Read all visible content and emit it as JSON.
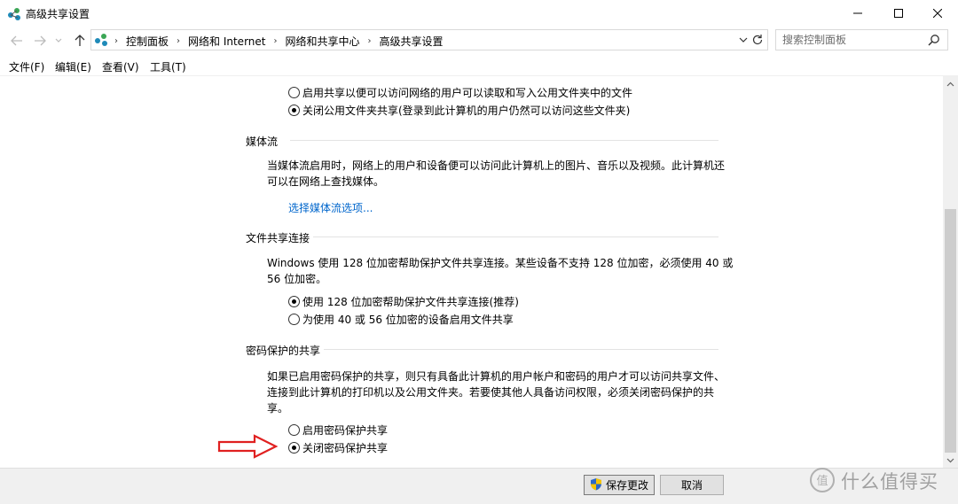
{
  "window": {
    "title": "高级共享设置",
    "minimize_glyph": "–",
    "maximize_glyph": "□",
    "close_glyph": "✕"
  },
  "nav": {
    "breadcrumbs": [
      "控制面板",
      "网络和 Internet",
      "网络和共享中心",
      "高级共享设置"
    ],
    "separator": "›",
    "search_placeholder": "搜索控制面板"
  },
  "menu": {
    "items": [
      "文件(F)",
      "编辑(E)",
      "查看(V)",
      "工具(T)"
    ]
  },
  "public_folder": {
    "option_on": "启用共享以便可以访问网络的用户可以读取和写入公用文件夹中的文件",
    "option_off": "关闭公用文件夹共享(登录到此计算机的用户仍然可以访问这些文件夹)",
    "selected": "off"
  },
  "media_streaming": {
    "heading": "媒体流",
    "description_lines": [
      "当媒体流启用时，网络上的用户和设备便可以访问此计算机上的图片、音乐以及视频。此计算机还",
      "可以在网络上查找媒体。"
    ],
    "link": "选择媒体流选项..."
  },
  "file_sharing": {
    "heading": "文件共享连接",
    "description_lines": [
      "Windows 使用 128 位加密帮助保护文件共享连接。某些设备不支持 128 位加密，必须使用 40 或",
      "56 位加密。"
    ],
    "option_128": "使用 128 位加密帮助保护文件共享连接(推荐)",
    "option_40_56": "为使用 40 或 56 位加密的设备启用文件共享",
    "selected": "128"
  },
  "password_sharing": {
    "heading": "密码保护的共享",
    "description_lines": [
      "如果已启用密码保护的共享，则只有具备此计算机的用户帐户和密码的用户才可以访问共享文件、",
      "连接到此计算机的打印机以及公用文件夹。若要使其他人具备访问权限，必须关闭密码保护的共",
      "享。"
    ],
    "option_on": "启用密码保护共享",
    "option_off": "关闭密码保护共享",
    "selected": "off"
  },
  "footer": {
    "save_label": "保存更改",
    "cancel_label": "取消"
  },
  "watermark": {
    "text": "什么值得买",
    "symbol": "值"
  },
  "colors": {
    "link": "#0066cc",
    "arrow_annotation": "#e02020",
    "footer_bg": "#f0f0f0"
  }
}
